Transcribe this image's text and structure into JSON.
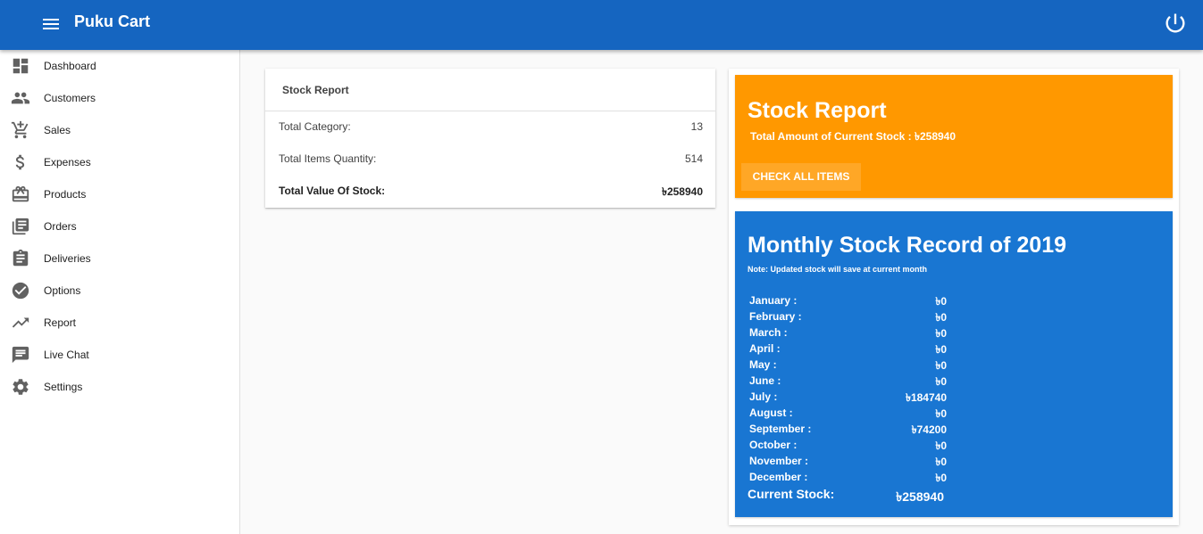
{
  "app": {
    "title": "Puku Cart"
  },
  "sidebar": {
    "items": [
      {
        "label": "Dashboard",
        "icon": "dashboard-icon"
      },
      {
        "label": "Customers",
        "icon": "people-icon"
      },
      {
        "label": "Sales",
        "icon": "cart-add-icon"
      },
      {
        "label": "Expenses",
        "icon": "dollar-icon"
      },
      {
        "label": "Products",
        "icon": "gift-icon"
      },
      {
        "label": "Orders",
        "icon": "library-books-icon"
      },
      {
        "label": "Deliveries",
        "icon": "clipboard-icon"
      },
      {
        "label": "Options",
        "icon": "check-circle-icon"
      },
      {
        "label": "Report",
        "icon": "trending-up-icon"
      },
      {
        "label": "Live Chat",
        "icon": "chat-icon"
      },
      {
        "label": "Settings",
        "icon": "gear-icon"
      }
    ]
  },
  "stock_card": {
    "title": "Stock Report",
    "rows": [
      {
        "label": "Total Category:",
        "value": "13"
      },
      {
        "label": "Total Items Quantity:",
        "value": "514"
      },
      {
        "label": "Total Value Of Stock:",
        "value": "৳258940"
      }
    ]
  },
  "summary": {
    "title": "Stock Report",
    "subtitle": "Total Amount of Current Stock : ৳258940",
    "button_label": "CHECK ALL ITEMS"
  },
  "monthly": {
    "title": "Monthly Stock Record of 2019",
    "note": "Note: Updated stock will save at current month",
    "months": [
      {
        "label": "January :",
        "value": "৳0"
      },
      {
        "label": "February :",
        "value": "৳0"
      },
      {
        "label": "March :",
        "value": "৳0"
      },
      {
        "label": "April :",
        "value": "৳0"
      },
      {
        "label": "May :",
        "value": "৳0"
      },
      {
        "label": "June :",
        "value": "৳0"
      },
      {
        "label": "July :",
        "value": "৳184740"
      },
      {
        "label": "August :",
        "value": "৳0"
      },
      {
        "label": "September :",
        "value": "৳74200"
      },
      {
        "label": "October :",
        "value": "৳0"
      },
      {
        "label": "November :",
        "value": "৳0"
      },
      {
        "label": "December :",
        "value": "৳0"
      }
    ],
    "current_label": "Current Stock:",
    "current_value": "৳258940"
  },
  "colors": {
    "appbar": "#1565c0",
    "summary_card": "#ff9800",
    "monthly_card": "#1976d2",
    "icon_gray": "#616161"
  }
}
